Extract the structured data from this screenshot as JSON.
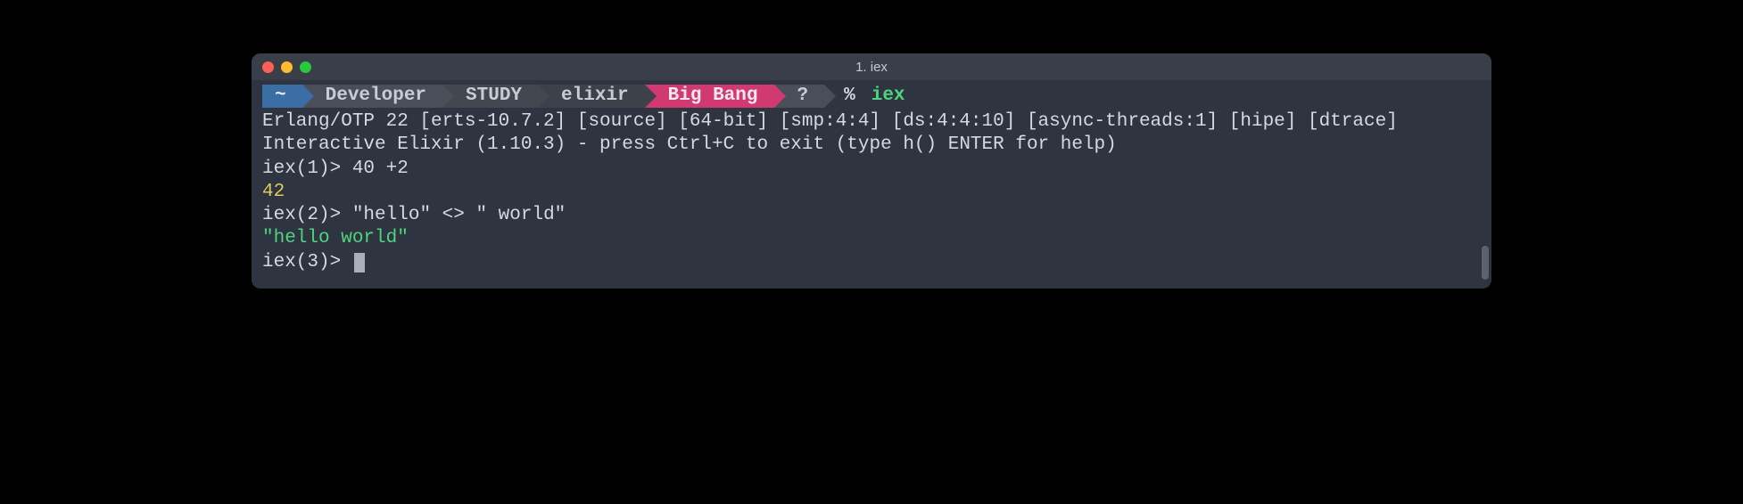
{
  "window": {
    "title": "1. iex"
  },
  "breadcrumb": {
    "home": "~",
    "segments": [
      "Developer",
      "STUDY",
      "elixir"
    ],
    "git_branch": "Big Bang",
    "git_status": "?",
    "prompt_symbol": "%",
    "command": "iex"
  },
  "output": {
    "erlang_banner": "Erlang/OTP 22 [erts-10.7.2] [source] [64-bit] [smp:4:4] [ds:4:4:10] [async-threads:1] [hipe] [dtrace]",
    "blank": "",
    "elixir_banner": "Interactive Elixir (1.10.3) - press Ctrl+C to exit (type h() ENTER for help)",
    "lines": [
      {
        "prompt": "iex(1)> ",
        "input": "40 +2"
      },
      {
        "result": "42",
        "color": "yellow"
      },
      {
        "prompt": "iex(2)> ",
        "input": "\"hello\" <> \" world\""
      },
      {
        "result": "\"hello world\"",
        "color": "green"
      },
      {
        "prompt": "iex(3)> ",
        "cursor": true
      }
    ]
  }
}
